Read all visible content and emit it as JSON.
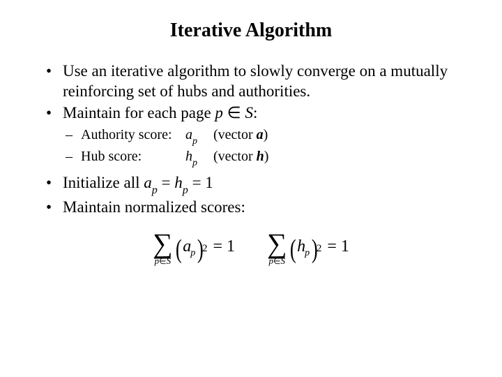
{
  "title": "Iterative Algorithm",
  "bullets": {
    "b1": "Use an iterative algorithm to slowly converge on a mutually reinforcing set of hubs and authorities.",
    "b2_pre": "Maintain for each page ",
    "b2_p": "p",
    "b2_mid": " ∈ ",
    "b2_S": "S",
    "b2_post": ":",
    "b3_pre": "Initialize all ",
    "b3_a": "a",
    "b3_p1": "p",
    "b3_eq1": " = ",
    "b3_h": "h",
    "b3_p2": "p",
    "b3_eq2": " = 1",
    "b4": "Maintain normalized scores:"
  },
  "inner": {
    "i1_lbl": "Authority score:",
    "i1_sym": "a",
    "i1_sub": "p",
    "i1_vec_pre": "(vector ",
    "i1_vec": "a",
    "i1_vec_post": ")",
    "i2_lbl": "Hub score:",
    "i2_sym": "h",
    "i2_sub": "p",
    "i2_vec_pre": "(vector ",
    "i2_vec": "h",
    "i2_vec_post": ")"
  },
  "eq": {
    "sigma": "∑",
    "lim1_p": "p",
    "lim1_el": "∈",
    "lim1_S": "S",
    "lp": "(",
    "rp": ")",
    "a": "a",
    "h": "h",
    "p": "p",
    "sq": "2",
    "eq": "=",
    "one": "1"
  }
}
